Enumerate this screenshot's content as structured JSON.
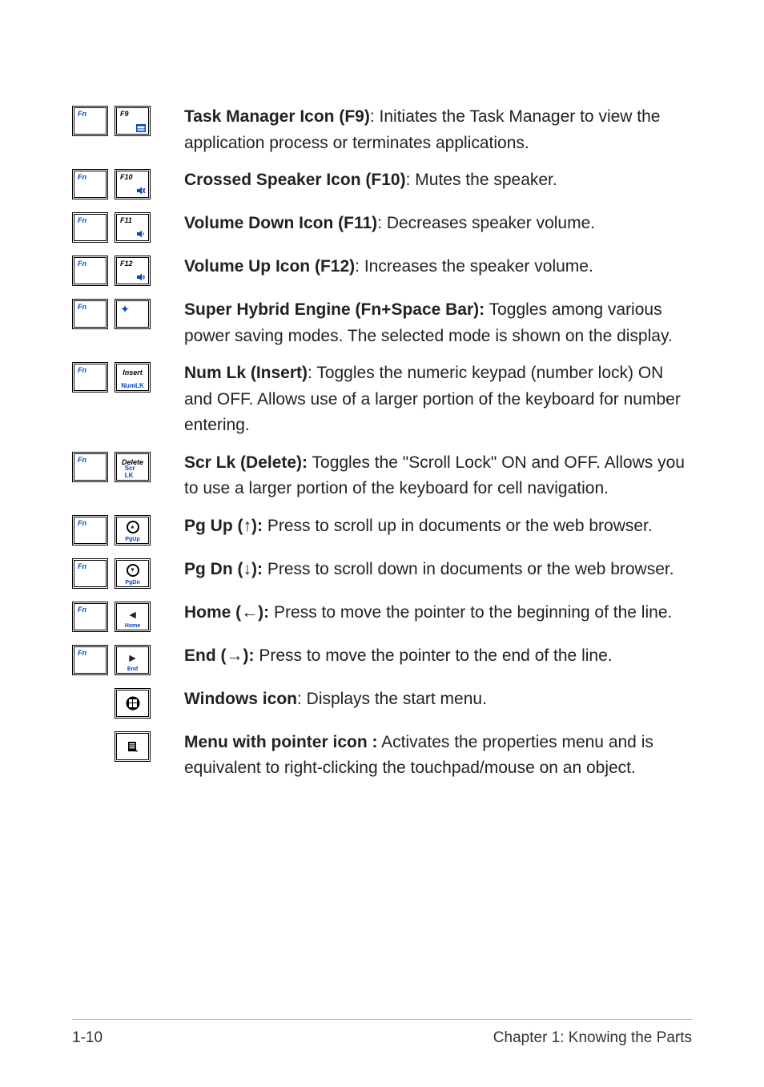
{
  "rows": [
    {
      "id": "task-manager",
      "keys": [
        {
          "type": "fn"
        },
        {
          "type": "f",
          "label": "F9",
          "glyph": "task"
        }
      ],
      "title": "Task Manager Icon (F9)",
      "sep": ": ",
      "body": "Initiates the Task Manager to view the application process or terminates applications."
    },
    {
      "id": "crossed-speaker",
      "keys": [
        {
          "type": "fn"
        },
        {
          "type": "f",
          "label": "F10",
          "glyph": "mute"
        }
      ],
      "title": "Crossed Speaker Icon (F10)",
      "sep": ": ",
      "body": "Mutes the speaker."
    },
    {
      "id": "volume-down",
      "keys": [
        {
          "type": "fn"
        },
        {
          "type": "f",
          "label": "F11",
          "glyph": "voldown"
        }
      ],
      "title": "Volume Down Icon (F11)",
      "sep": ": ",
      "body": "Decreases speaker volume."
    },
    {
      "id": "volume-up",
      "keys": [
        {
          "type": "fn"
        },
        {
          "type": "f",
          "label": "F12",
          "glyph": "volup"
        }
      ],
      "title": "Volume Up Icon (F12)",
      "sep": ": ",
      "body": "Increases the speaker volume."
    },
    {
      "id": "super-hybrid",
      "keys": [
        {
          "type": "fn"
        },
        {
          "type": "space"
        }
      ],
      "title": "Super Hybrid Engine (Fn+Space Bar):",
      "sep": " ",
      "body": "Toggles among various power saving modes. The selected mode is shown on the display."
    },
    {
      "id": "num-lk",
      "keys": [
        {
          "type": "fn"
        },
        {
          "type": "text",
          "top": "Insert",
          "sub": "NumLK"
        }
      ],
      "title": "Num Lk (Insert)",
      "sep": ": ",
      "body": "Toggles the numeric keypad (number lock) ON and OFF. Allows use of a larger portion of the keyboard for number entering."
    },
    {
      "id": "scr-lk",
      "keys": [
        {
          "type": "fn"
        },
        {
          "type": "text",
          "top": "Delete",
          "sub": "Scr LK"
        }
      ],
      "title": "Scr Lk (Delete):",
      "sep": " ",
      "body": "Toggles the \"Scroll Lock\" ON and OFF. Allows you to use a larger portion of the keyboard for cell navigation."
    },
    {
      "id": "pg-up",
      "keys": [
        {
          "type": "fn"
        },
        {
          "type": "arrow",
          "dir": "up",
          "sub": "PgUp"
        }
      ],
      "title": "Pg Up (↑):",
      "sep": " ",
      "body": "Press to scroll up in documents or the web browser."
    },
    {
      "id": "pg-dn",
      "keys": [
        {
          "type": "fn"
        },
        {
          "type": "arrow",
          "dir": "down",
          "sub": "PgDn"
        }
      ],
      "title": "Pg Dn (↓):",
      "sep": " ",
      "body": "Press to scroll down in documents or the web browser."
    },
    {
      "id": "home",
      "keys": [
        {
          "type": "fn"
        },
        {
          "type": "arrow",
          "dir": "left",
          "sub": "Home"
        }
      ],
      "title": "Home (←):",
      "sep": " ",
      "body": "Press to move the pointer to the beginning of the line."
    },
    {
      "id": "end",
      "keys": [
        {
          "type": "fn"
        },
        {
          "type": "arrow",
          "dir": "right",
          "sub": "End"
        }
      ],
      "title": "End (→):",
      "sep": " ",
      "body": "Press to move the pointer to the end of the line."
    },
    {
      "id": "windows",
      "keys": [
        {
          "type": "spacer"
        },
        {
          "type": "win"
        }
      ],
      "title": "Windows icon",
      "sep": ": ",
      "body": "Displays the start menu."
    },
    {
      "id": "menu",
      "keys": [
        {
          "type": "spacer"
        },
        {
          "type": "menu"
        }
      ],
      "title": "Menu with pointer icon :",
      "sep": " ",
      "body": "Activates the properties menu and is equivalent to right-clicking the touchpad/mouse on an object."
    }
  ],
  "footer": {
    "left": "1-10",
    "right": "Chapter 1: Knowing the Parts"
  }
}
